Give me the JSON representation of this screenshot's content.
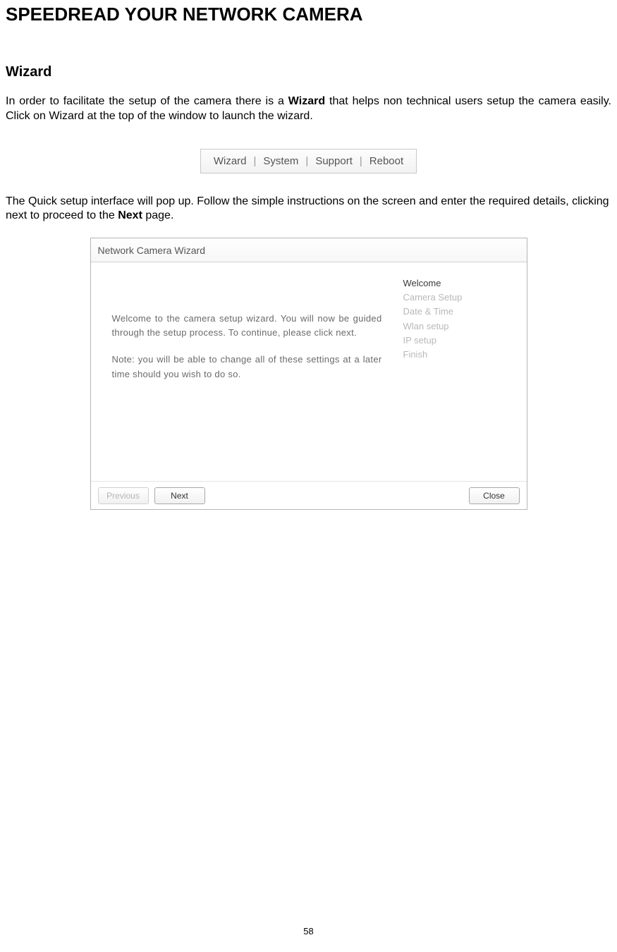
{
  "header": "SPEEDREAD YOUR NETWORK CAMERA",
  "section_title": "Wizard",
  "paragraphs": {
    "p1_pre": "In order to facilitate the setup of the camera there is a ",
    "p1_bold": "Wizard",
    "p1_post": " that helps non technical users setup the camera easily. Click on Wizard at the top of the window to launch the wizard.",
    "p2_pre": "The Quick setup interface will pop up. Follow the simple instructions on the screen and enter the required details, clicking next to proceed to the ",
    "p2_bold": "Next",
    "p2_post": " page."
  },
  "menu_bar": {
    "wizard": "Wizard",
    "system": "System",
    "support": "Support",
    "reboot": "Reboot",
    "sep": "|"
  },
  "wizard_window": {
    "title": "Network Camera Wizard",
    "welcome_p1": "Welcome to the camera setup wizard. You will now be guided through the setup process. To continue, please click next.",
    "welcome_p2": "Note: you will be able to change all of these settings at a later time should you wish to do so.",
    "steps": [
      "Welcome",
      "Camera Setup",
      "Date & Time",
      "Wlan setup",
      "IP setup",
      "Finish"
    ],
    "active_step_index": 0,
    "buttons": {
      "previous": "Previous",
      "next": "Next",
      "close": "Close"
    }
  },
  "page_number": "58"
}
